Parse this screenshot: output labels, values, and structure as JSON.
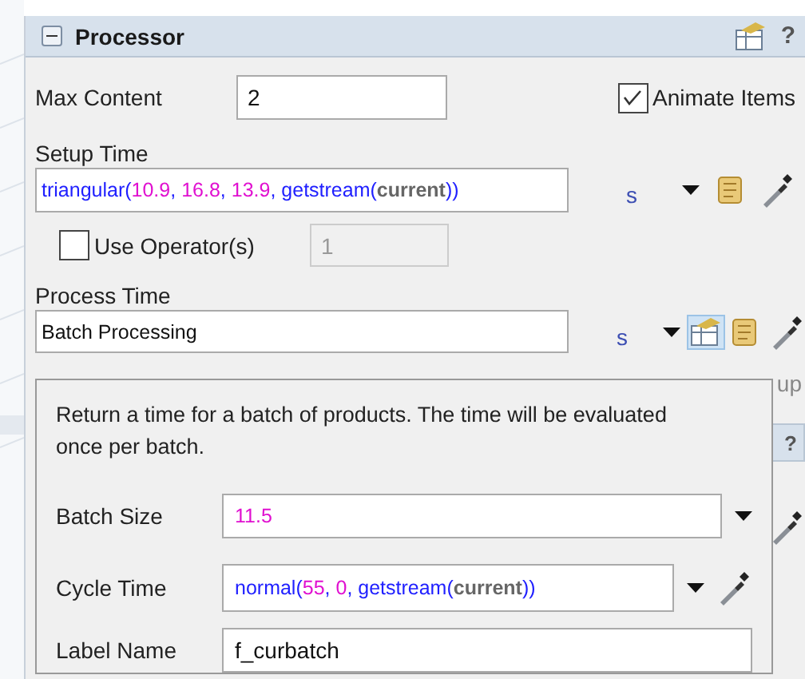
{
  "panel": {
    "title": "Processor",
    "expanded": true
  },
  "max_content": {
    "label": "Max Content",
    "value": "2"
  },
  "animate_items": {
    "label": "Animate Items",
    "checked": true
  },
  "setup_time": {
    "label": "Setup Time",
    "tokens": [
      {
        "kind": "function",
        "text": "triangular("
      },
      {
        "kind": "number",
        "text": "10.9"
      },
      {
        "kind": "function",
        "text": ", "
      },
      {
        "kind": "number",
        "text": "16.8"
      },
      {
        "kind": "function",
        "text": ", "
      },
      {
        "kind": "number",
        "text": "13.9"
      },
      {
        "kind": "function",
        "text": ", getstream("
      },
      {
        "kind": "keyword",
        "text": "current"
      },
      {
        "kind": "function",
        "text": "))"
      }
    ],
    "unit": "s"
  },
  "use_operators": {
    "label": "Use Operator(s)",
    "checked": false,
    "value": "1"
  },
  "process_time": {
    "label": "Process Time",
    "value": "Batch Processing",
    "unit": "s"
  },
  "behind": {
    "text": "up",
    "help": "?"
  },
  "popup": {
    "description": "Return a time for a batch of products. The time will be evaluated once per batch.",
    "fields": [
      {
        "label": "Batch Size",
        "kind": "dropdown",
        "tokens": [
          {
            "kind": "number",
            "text": "11.5"
          }
        ]
      },
      {
        "label": "Cycle Time",
        "kind": "dropdown-picker",
        "tokens": [
          {
            "kind": "function",
            "text": "normal("
          },
          {
            "kind": "number",
            "text": "55"
          },
          {
            "kind": "function",
            "text": ", "
          },
          {
            "kind": "number",
            "text": "0"
          },
          {
            "kind": "function",
            "text": ", getstream("
          },
          {
            "kind": "keyword",
            "text": "current"
          },
          {
            "kind": "function",
            "text": "))"
          }
        ]
      },
      {
        "label": "Label Name",
        "kind": "text",
        "tokens": [
          {
            "kind": "plain",
            "text": "f_curbatch"
          }
        ]
      }
    ]
  }
}
